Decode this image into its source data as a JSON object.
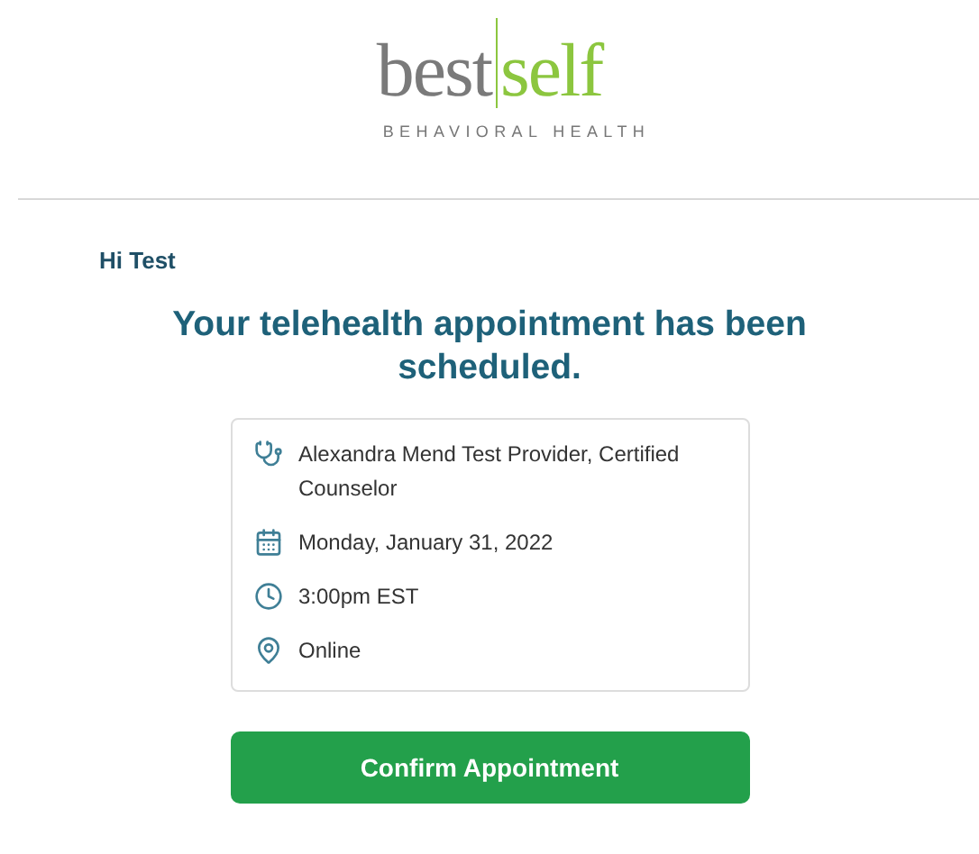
{
  "logo": {
    "first": "best",
    "second": "self",
    "tagline": "BEHAVIORAL HEALTH"
  },
  "greeting": "Hi Test",
  "heading": "Your telehealth appointment has been scheduled.",
  "details": [
    {
      "kind": "provider",
      "text": "Alexandra Mend Test Provider, Certified Counselor"
    },
    {
      "kind": "date",
      "text": "Monday, January 31, 2022"
    },
    {
      "kind": "time",
      "text": "3:00pm EST"
    },
    {
      "kind": "location",
      "text": "Online"
    }
  ],
  "button": "Confirm Appointment"
}
